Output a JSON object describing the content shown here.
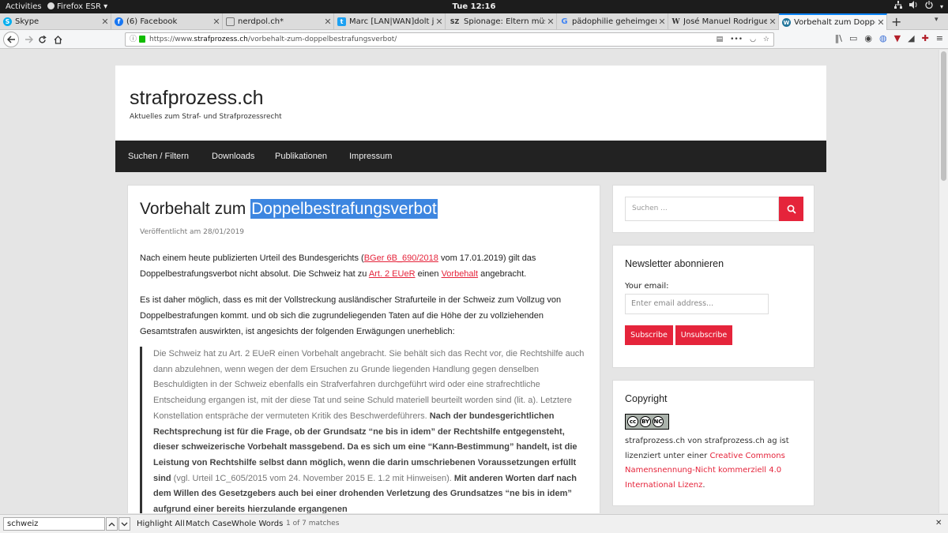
{
  "system_bar": {
    "activities": "Activities",
    "app": "Firefox ESR",
    "clock": "Tue 12:16"
  },
  "tabs": [
    {
      "title": "Skype",
      "icon": "skype-icon",
      "color": "#00aff0",
      "glyph": "S"
    },
    {
      "title": "(6) Facebook",
      "icon": "facebook-icon",
      "color": "#1877f2",
      "glyph": "f"
    },
    {
      "title": "nerdpol.ch*",
      "icon": "nerdpol-icon",
      "color": "#777777",
      "glyph": ""
    },
    {
      "title": "Marc [LAN|WAN]dolt ju",
      "icon": "twitter-icon",
      "color": "#1da1f2",
      "glyph": "t"
    },
    {
      "title": "Spionage: Eltern müssen",
      "icon": "sz-icon",
      "color": "#333333",
      "glyph": "SZ"
    },
    {
      "title": "pädophilie geheimgerich",
      "icon": "google-icon",
      "color": "#4285f4",
      "glyph": "G"
    },
    {
      "title": "José Manuel Rodriguez D",
      "icon": "wikipedia-icon",
      "color": "#555555",
      "glyph": "W"
    },
    {
      "title": "Vorbehalt zum Doppelbe",
      "icon": "wordpress-icon",
      "color": "#21759b",
      "glyph": "W"
    }
  ],
  "url": {
    "prefix": "https://www.",
    "domain": "strafprozess.ch",
    "path": "/vorbehalt-zum-doppelbestrafungsverbot/"
  },
  "site": {
    "title": "strafprozess.ch",
    "description": "Aktuelles zum Straf- und Strafprozessrecht",
    "nav": [
      "Suchen / Filtern",
      "Downloads",
      "Publikationen",
      "Impressum"
    ]
  },
  "article": {
    "title_part1": "Vorbehalt zum ",
    "title_highlight": "Doppelbestrafungsverbot",
    "meta": "Veröffentlicht am 28/01/2019",
    "p1_a": "Nach einem heute publizierten Urteil des Bundesgerichts (",
    "p1_link1": "BGer 6B_690/2018",
    "p1_b": " vom 17.01.2019) gilt das Doppelbestrafungsverbot nicht absolut. Die Schweiz hat zu ",
    "p1_link2": "Art. 2 EUeR",
    "p1_c": " einen ",
    "p1_link3": "Vorbehalt",
    "p1_d": " angebracht.",
    "p2": "Es ist daher möglich, dass es mit der Vollstreckung ausländischer Strafurteile in der Schweiz zum Vollzug von Doppelbestrafungen kommt. und ob sich die zugrundeliegenden Taten auf die Höhe der zu vollziehenden Gesamtstrafen auswirkten, ist angesichts der folgenden Erwägungen unerheblich:",
    "quote_a": "Die Schweiz hat zu Art. 2 EUeR einen Vorbehalt angebracht. Sie behält sich das Recht vor, die Rechtshilfe auch dann abzulehnen, wenn wegen der dem Ersuchen zu Grunde liegenden Handlung gegen denselben Beschuldigten in der Schweiz ebenfalls ein Strafverfahren durchgeführt wird oder eine strafrechtliche Entscheidung ergangen ist, mit der diese Tat und seine Schuld materiell beurteilt worden sind (lit. a). Letztere Konstellation entspräche der vermuteten Kritik des Beschwerdeführers. ",
    "quote_b": "Nach der bundesgerichtlichen Rechtsprechung ist für die Frage, ob der Grundsatz “ne bis in idem” der Rechtshilfe entgegensteht, dieser schweizerische Vorbehalt massgebend. Da es sich um eine “Kann-Bestimmung” handelt, ist die Leistung von Rechtshilfe selbst dann möglich, wenn die darin umschriebenen Voraussetzungen erfüllt sind",
    "quote_c": " (vgl. Urteil 1C_605/2015 vom 24. November 2015 E. 1.2 mit Hinweisen). ",
    "quote_d": "Mit anderen Worten darf nach dem Willen des Gesetzgebers auch bei einer drohenden Verletzung des Grundsatzes “ne bis in idem” aufgrund einer bereits hierzulande ergangenen"
  },
  "sidebar": {
    "search_placeholder": "Suchen ...",
    "newsletter": {
      "title": "Newsletter abonnieren",
      "email_label": "Your email:",
      "email_placeholder": "Enter email address...",
      "subscribe": "Subscribe",
      "unsubscribe": "Unsubscribe"
    },
    "copyright": {
      "title": "Copyright",
      "badge_by": "BY",
      "badge_nc": "NC",
      "text_a": "strafprozess.ch von strafprozess.ch ag ist lizenziert unter einer ",
      "link": "Creative Commons Namensnennung-Nicht kommerziell 4.0 International Lizenz",
      "text_b": "."
    }
  },
  "findbar": {
    "query": "schweiz",
    "highlight_all": "Highlight All",
    "match_case": "Match Case",
    "whole_words": "Whole Words",
    "count": "1 of 7 matches"
  },
  "colors": {
    "accent": "#e5243b",
    "selection": "#3d86e0",
    "nav_bg": "#222222"
  }
}
